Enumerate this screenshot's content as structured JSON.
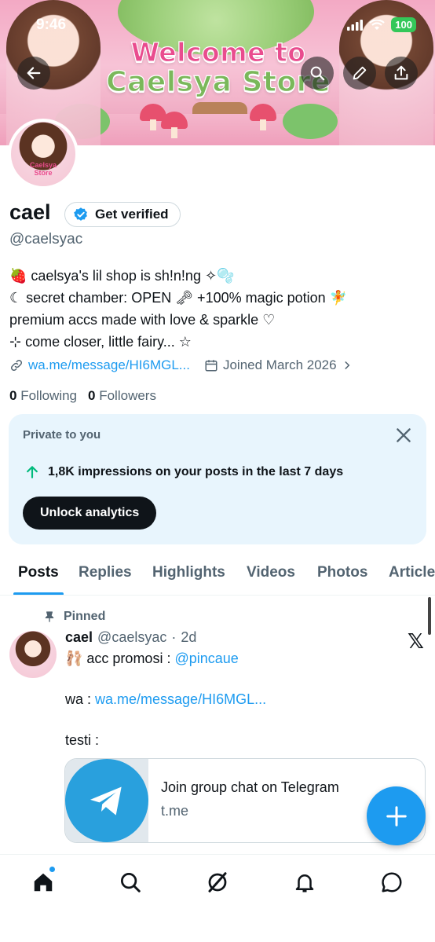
{
  "status": {
    "time": "9:46",
    "battery": "100"
  },
  "banner": {
    "line1": "Welcome to",
    "line2": "Caelsya Store"
  },
  "avatar": {
    "label_top": "Caelsya",
    "label_bottom": "Store"
  },
  "profile": {
    "name": "cael",
    "verify_label": "Get verified",
    "handle": "@caelsyac",
    "bio": [
      "🍓 caelsya's lil shop is sh!n!ng ✧🫧",
      "☾ secret chamber: OPEN 🗝 +100% magic potion 🧚",
      "premium accs made with love & sparkle ♡",
      "⊹ come closer, little fairy... ☆"
    ],
    "link": "wa.me/message/HI6MGL...",
    "joined": "Joined March 2026",
    "following_count": "0",
    "following_label": "Following",
    "followers_count": "0",
    "followers_label": "Followers"
  },
  "private_card": {
    "label": "Private to you",
    "impressions": "1,8K impressions on your posts in the last 7 days",
    "button": "Unlock analytics"
  },
  "tabs": [
    "Posts",
    "Replies",
    "Highlights",
    "Videos",
    "Photos",
    "Articles"
  ],
  "post": {
    "pinned_label": "Pinned",
    "name": "cael",
    "handle": "@caelsyac",
    "time": "2d",
    "line1_prefix": "🩰 acc promosi : ",
    "line1_mention": "@pincaue",
    "line2_prefix": "wa : ",
    "line2_link": "wa.me/message/HI6MGL...",
    "line3": "testi :",
    "card_title": "Join group chat on Telegram",
    "card_domain": "t.me"
  },
  "colors": {
    "accent": "#1d9bf0",
    "text": "#0f1419",
    "muted": "#536471",
    "card_bg": "#e8f5fd"
  }
}
